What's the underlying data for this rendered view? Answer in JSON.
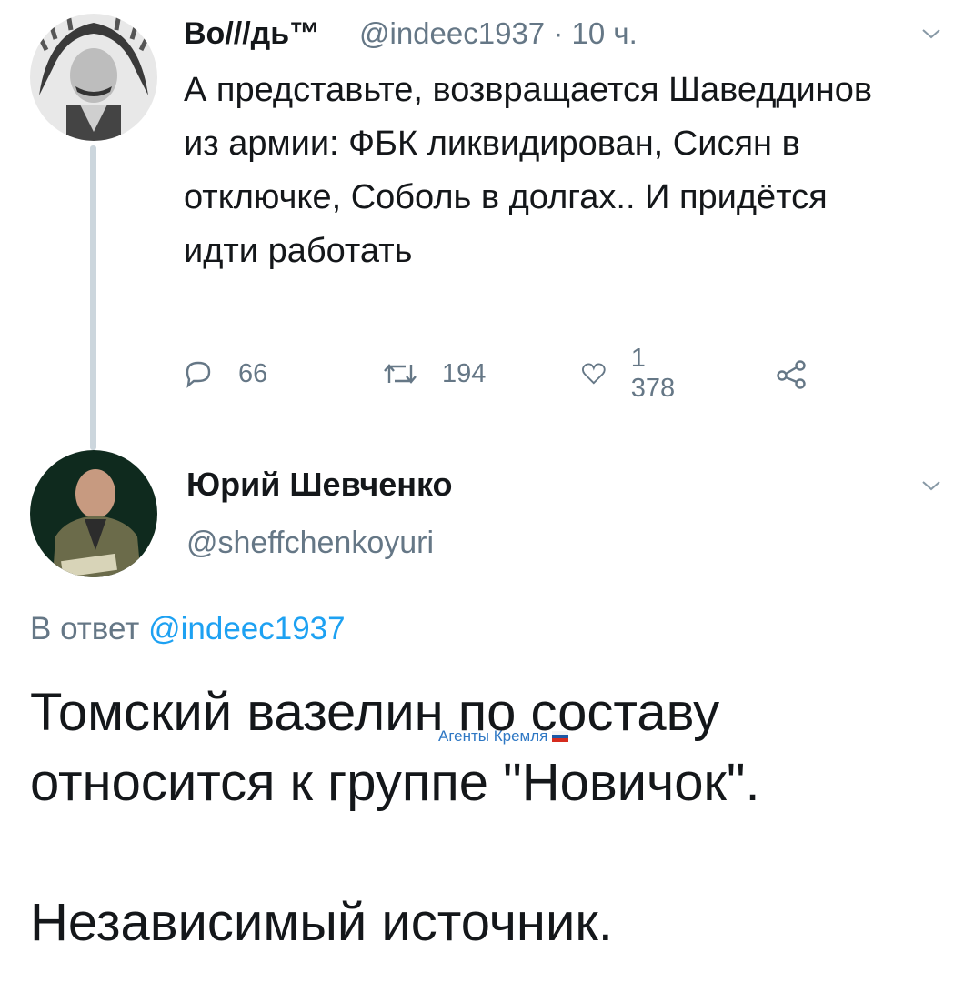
{
  "tweet1": {
    "author_name": "Во///дь™",
    "handle": "@indeec1937",
    "separator": "·",
    "time": "10 ч.",
    "text": "А представьте, возвращается Шаведдинов из армии: ФБК ликвидирован, Сисян в отключке, Соболь в долгах.. И придётся идти работать",
    "actions": {
      "replies": "66",
      "retweets": "194",
      "likes": "1 378"
    },
    "icons": [
      "reply-icon",
      "retweet-icon",
      "like-icon",
      "share-icon",
      "chevron-down-icon"
    ]
  },
  "tweet2": {
    "author_name": "Юрий Шевченко",
    "handle": "@sheffchenkoyuri",
    "reply_prefix": "В ответ",
    "reply_to": "@indeec1937",
    "text": "Томский вазелин по составу относится к группе \"Новичок\".\n\nНезависимый источник."
  },
  "watermark": {
    "text": "Агенты Кремля",
    "flag_colors": [
      "#ffffff",
      "#1c57a5",
      "#d52b1e"
    ]
  },
  "colors": {
    "text": "#14171a",
    "secondary": "#657786",
    "link": "#1da1f2",
    "thread_line": "#ccd6dd"
  }
}
